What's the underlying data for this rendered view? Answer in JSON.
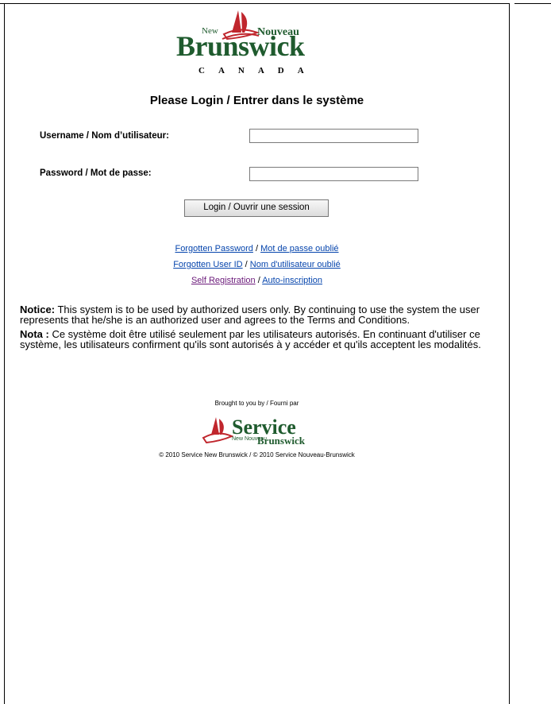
{
  "header": {
    "logo_new": "New",
    "logo_nouveau": "Nouveau",
    "logo_brunswick": "Brunswick",
    "logo_canada": "CANADA"
  },
  "page_title": "Please Login / Entrer dans le système",
  "form": {
    "username_label": "Username / Nom d’utilisateur:",
    "username_value": "",
    "password_label": "Password / Mot de passe:",
    "password_value": "",
    "login_button": "Login / Ouvrir une session"
  },
  "links": {
    "forgot_password_en": "Forgotten Password",
    "forgot_password_fr": "Mot de passe oublié",
    "forgot_userid_en": "Forgotten User ID",
    "forgot_userid_fr": "Nom d'utilisateur oublié",
    "self_reg_en": "Self Registration",
    "self_reg_fr": "Auto-inscription",
    "separator": " / "
  },
  "notice": {
    "en_label": "Notice:",
    "en_text": " This system is to be used by authorized users only. By continuing to use the system the user represents that he/she is an authorized user and agrees to the Terms and Conditions.",
    "fr_label": "Nota :",
    "fr_text": " Ce système doit être utilisé seulement par les utilisateurs autorisés. En continuant d'utiliser ce système, les utilisateurs confirment qu'ils sont autorisés à y accéder et qu'ils acceptent les modalités."
  },
  "footer": {
    "brought_by": "Brought to you by / Fourni par",
    "sn_service": "Service",
    "sn_new": "New Nouveau",
    "sn_brunswick": "Brunswick",
    "copyright": "© 2010 Service New Brunswick / © 2010 Service Nouveau-Brunswick"
  },
  "colors": {
    "logo_green": "#1f5b2e",
    "logo_red": "#c0262d",
    "link": "#0645ad",
    "visited_link": "#6b1a7a"
  }
}
